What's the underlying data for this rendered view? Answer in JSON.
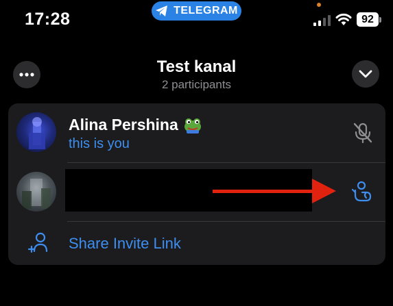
{
  "status_bar": {
    "time": "17:28",
    "app_pill": "TELEGRAM",
    "battery": "92"
  },
  "header": {
    "title": "Test kanal",
    "subtitle": "2 participants"
  },
  "participants": [
    {
      "name": "Alina Pershina",
      "status": "this is you",
      "emoji_icon": "frog-emoji-icon",
      "action_icon": "microphone-muted-icon"
    },
    {
      "name": "",
      "status": "",
      "action_icon": "raise-hand-icon"
    }
  ],
  "invite": {
    "label": "Share Invite Link"
  },
  "colors": {
    "accent": "#3d8ef0",
    "card": "#1c1c1e",
    "annotation_arrow": "#e0220f",
    "telegram_pill": "#2a82e4"
  }
}
